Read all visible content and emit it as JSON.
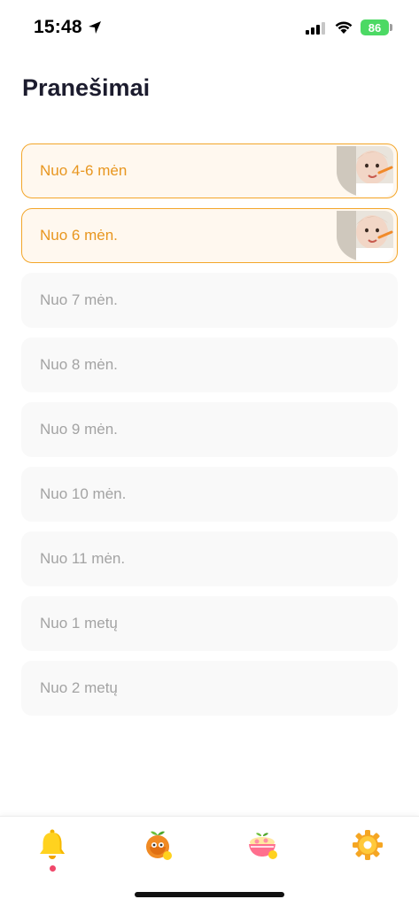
{
  "status_bar": {
    "time": "15:48",
    "battery": "86"
  },
  "page": {
    "title": "Pranešimai"
  },
  "age_items": [
    {
      "label": "Nuo 4-6 mėn",
      "active": true
    },
    {
      "label": "Nuo 6 mėn.",
      "active": true
    },
    {
      "label": "Nuo 7 mėn.",
      "active": false
    },
    {
      "label": "Nuo 8 mėn.",
      "active": false
    },
    {
      "label": "Nuo 9 mėn.",
      "active": false
    },
    {
      "label": "Nuo 10 mėn.",
      "active": false
    },
    {
      "label": "Nuo 11 mėn.",
      "active": false
    },
    {
      "label": "Nuo 1 metų",
      "active": false
    },
    {
      "label": "Nuo 2 metų",
      "active": false
    }
  ],
  "tabs": [
    {
      "icon": "bell-icon",
      "selected": true
    },
    {
      "icon": "fruit-icon",
      "selected": false
    },
    {
      "icon": "food-bowl-icon",
      "selected": false
    },
    {
      "icon": "gear-icon",
      "selected": false
    }
  ],
  "colors": {
    "accent": "#f3a62a",
    "accent_text": "#e8961f",
    "inactive_text": "#a3a3a3",
    "item_bg": "#f9f9f9",
    "badge_dot": "#f0476a",
    "battery": "#4cd964"
  }
}
